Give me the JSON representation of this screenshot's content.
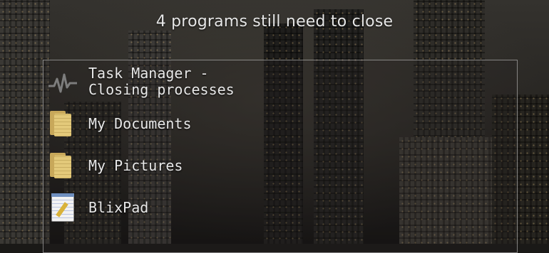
{
  "dialog": {
    "title": "4 programs still need to close",
    "programs": [
      {
        "label": "Task Manager -\nClosing processes",
        "icon": "task-manager-icon"
      },
      {
        "label": "My Documents",
        "icon": "folder-icon"
      },
      {
        "label": "My Pictures",
        "icon": "folder-icon"
      },
      {
        "label": "BlixPad",
        "icon": "notepad-icon"
      }
    ]
  },
  "colors": {
    "text": "#e8e8e8",
    "panel_border": "#d2d2d2",
    "folder": "#e3c97a"
  }
}
